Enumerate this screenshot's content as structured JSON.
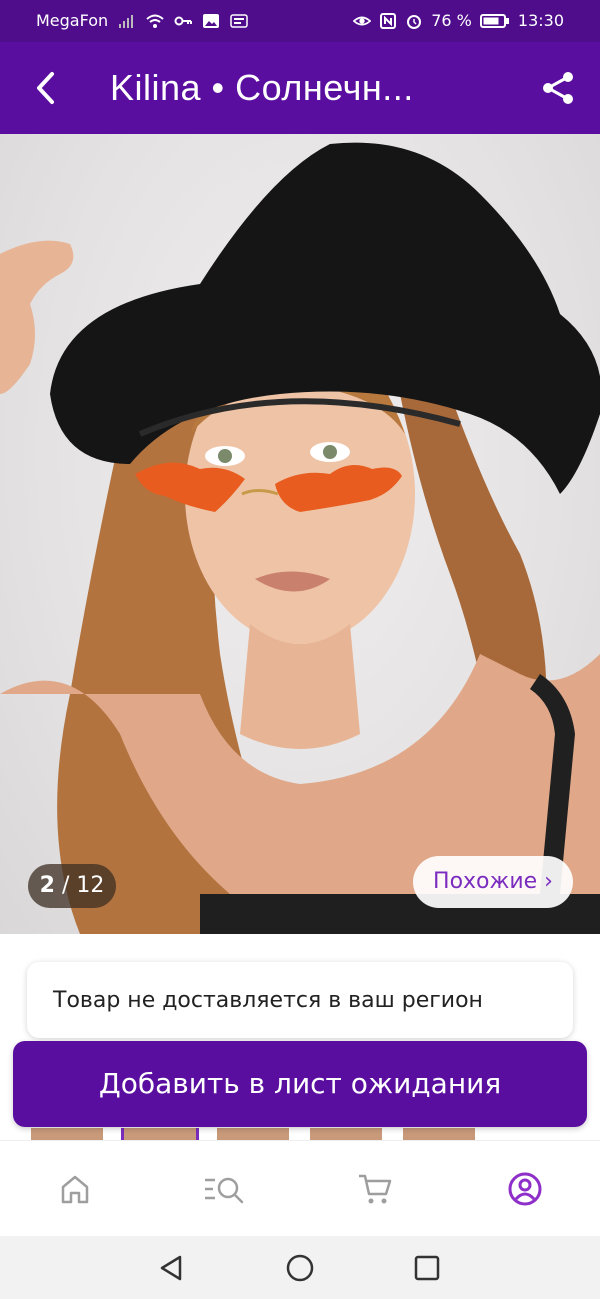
{
  "status_bar": {
    "carrier": "MegaFon",
    "battery": "76 %",
    "time": "13:30"
  },
  "header": {
    "title": "Kilina  •  Солнечн...",
    "back_icon": "back-arrow-icon",
    "share_icon": "share-icon"
  },
  "gallery": {
    "current": "2",
    "separator": " / ",
    "total": "12",
    "similar_label": "Похожие ›"
  },
  "notice": {
    "text": "Товар не доставляется в ваш регион"
  },
  "cta": {
    "label": "Добавить в лист ожидания"
  },
  "tabbar": {
    "items": [
      "home-icon",
      "catalog-search-icon",
      "cart-icon",
      "profile-icon"
    ],
    "active_color": "#8e2fc9"
  },
  "colors": {
    "brand": "#5a0ea0",
    "accent": "#7b2cbf"
  }
}
